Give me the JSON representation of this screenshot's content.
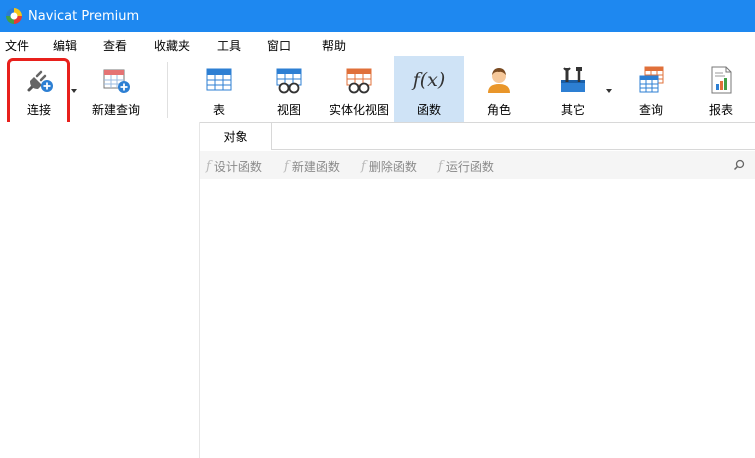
{
  "window": {
    "title": "Navicat Premium"
  },
  "menu": [
    "文件",
    "编辑",
    "查看",
    "收藏夹",
    "工具",
    "窗口",
    "帮助"
  ],
  "toolbar": {
    "connect_label": "连接",
    "new_query_label": "新建查询",
    "table_label": "表",
    "view_label": "视图",
    "mat_view_label": "实体化视图",
    "function_label": "函数",
    "role_label": "角色",
    "other_label": "其它",
    "query_label": "查询",
    "report_label": "报表",
    "function_icon_text": "f(x)"
  },
  "tabs": {
    "object_label": "对象"
  },
  "object_toolbar": {
    "design_label": "设计函数",
    "new_label": "新建函数",
    "delete_label": "删除函数",
    "run_label": "运行函数",
    "fx": "f"
  },
  "colors": {
    "titlebar": "#1e88f0",
    "active_tool": "#cfe3f6",
    "highlight": "#e8201c"
  }
}
